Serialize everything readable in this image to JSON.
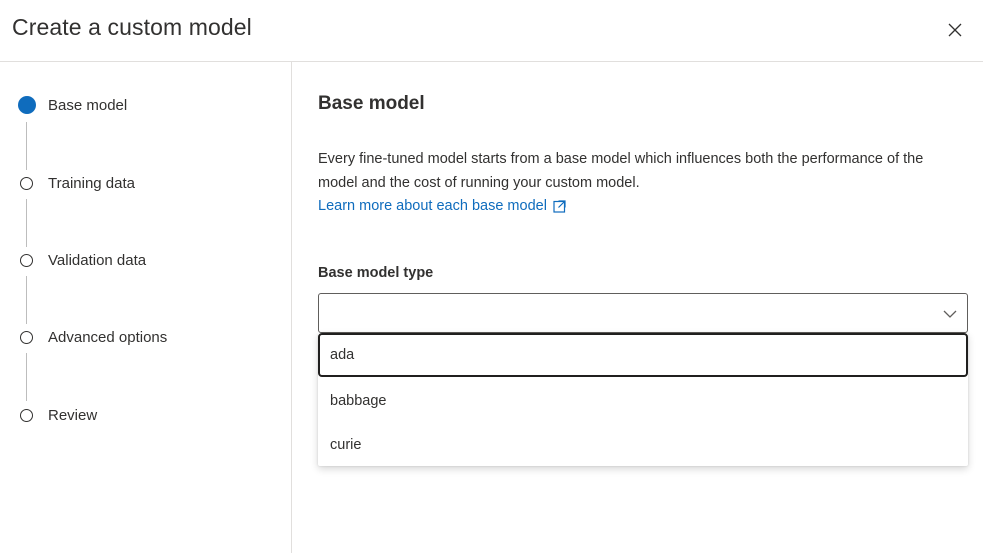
{
  "dialog": {
    "title": "Create a custom model"
  },
  "steps": [
    {
      "label": "Base model",
      "active": true
    },
    {
      "label": "Training data",
      "active": false
    },
    {
      "label": "Validation data",
      "active": false
    },
    {
      "label": "Advanced options",
      "active": false
    },
    {
      "label": "Review",
      "active": false
    }
  ],
  "main": {
    "section_title": "Base model",
    "description": "Every fine-tuned model starts from a base model which influences both the performance of the model and the cost of running your custom model.",
    "learn_more_link": "Learn more about each base model",
    "field_label": "Base model type",
    "selected_value": "",
    "options": [
      "ada",
      "babbage",
      "curie"
    ]
  },
  "colors": {
    "accent": "#0f6cbd",
    "text": "#323130",
    "divider": "#e1dfdd"
  },
  "icons": {
    "close": "close-icon",
    "external_link": "external-link-icon",
    "chevron": "chevron-down-icon"
  }
}
